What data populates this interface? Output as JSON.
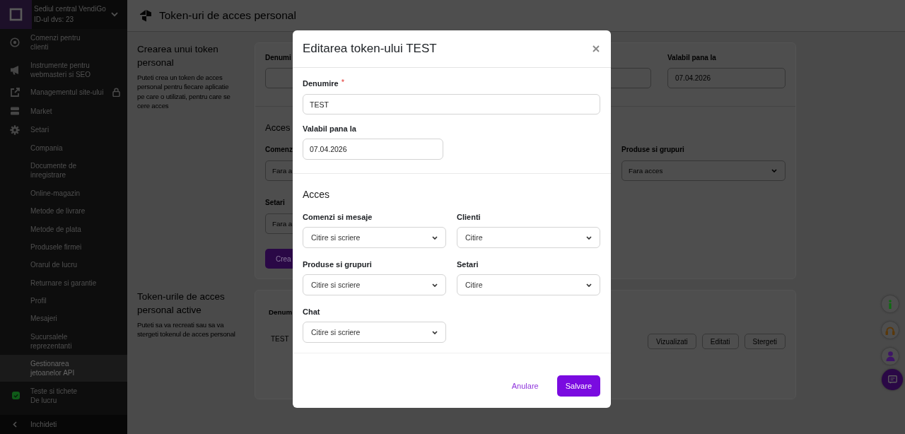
{
  "sidebar": {
    "account": {
      "name": "Sediul central VendiGo",
      "id_text": "ID-ul dvs: 23"
    },
    "items": [
      {
        "label": "Comenzi pentru\nclienti",
        "selected": false,
        "locked": false
      },
      {
        "label": "Instrumente pentru\nwebmasteri si SEO",
        "selected": false,
        "locked": false
      },
      {
        "label": "Managementul site-ului",
        "selected": false,
        "locked": true
      },
      {
        "label": "Market",
        "selected": false,
        "locked": false
      },
      {
        "label": "Setari",
        "selected": false,
        "locked": false,
        "children": [
          {
            "label": "Compania",
            "selected": false
          },
          {
            "label": "Documente de\ninregistrare",
            "selected": false
          },
          {
            "label": "Online-magazin",
            "selected": false
          },
          {
            "label": "Metode de livrare",
            "selected": false
          },
          {
            "label": "Metode de plata",
            "selected": false
          },
          {
            "label": "Produsele firmei",
            "selected": false
          },
          {
            "label": "Orarul de lucru",
            "selected": false
          },
          {
            "label": "Returnare si garantie",
            "selected": false
          },
          {
            "label": "Profil",
            "selected": false
          },
          {
            "label": "Mesajeri",
            "selected": false
          },
          {
            "label": "Sucursalele\nreprezentanti",
            "selected": false
          },
          {
            "label": "Gestionarea\njetoanelor API",
            "selected": true
          }
        ]
      },
      {
        "label": "Teste si tichete\nDe lucru",
        "selected": false,
        "locked": false
      }
    ],
    "footer": {
      "label": "Inchideti"
    }
  },
  "header": {
    "title": "Token-uri de acces personal"
  },
  "create_section": {
    "title": "Crearea unui token personal",
    "description": "Puteti crea un token de acces personal pentru fiecare aplicatie pe care o utilizati, pentru care se cere acces",
    "form": {
      "name_label": "Denumi",
      "valid_label": "Valabil pana la",
      "valid_value": "07.04.2026",
      "access_title": "Acces",
      "access_rows": [
        {
          "fields": [
            {
              "label": "Comenz",
              "value": "Fara a"
            },
            {
              "label": "Produse si grupuri",
              "value": "Fara acces"
            }
          ]
        },
        {
          "fields": [
            {
              "label": "Setari",
              "value": "Fara a"
            }
          ]
        }
      ],
      "submit_label": "Crea"
    }
  },
  "tokens_section": {
    "title": "Token-urile de acces personal active",
    "description": "Puteti sa va recreati sau sa va stergeti tokenul de acces personal",
    "table": {
      "columns": [
        "Denum"
      ],
      "rows": [
        {
          "cells": [
            "TEST"
          ],
          "actions": [
            "Vizualizati",
            "Editati",
            "Stergeti"
          ]
        }
      ]
    }
  },
  "modal": {
    "title": "Editarea token-ului TEST",
    "fields": [
      {
        "kind": "text",
        "label": "Denumire",
        "required_mark": "*",
        "value": "TEST"
      },
      {
        "kind": "date",
        "label": "Valabil pana la",
        "value": "07.04.2026"
      }
    ],
    "access_title": "Acces",
    "access_fields": [
      {
        "label": "Comenzi si mesaje",
        "value": "Citire si scriere"
      },
      {
        "label": "Clienti",
        "value": "Citire"
      },
      {
        "label": "Produse si grupuri",
        "value": "Citire si scriere"
      },
      {
        "label": "Setari",
        "value": "Citire"
      },
      {
        "label": "Chat",
        "value": "Citire si scriere"
      }
    ],
    "buttons": [
      {
        "kind": "link",
        "label": "Anulare"
      },
      {
        "kind": "primary",
        "label": "Salvare"
      }
    ]
  }
}
